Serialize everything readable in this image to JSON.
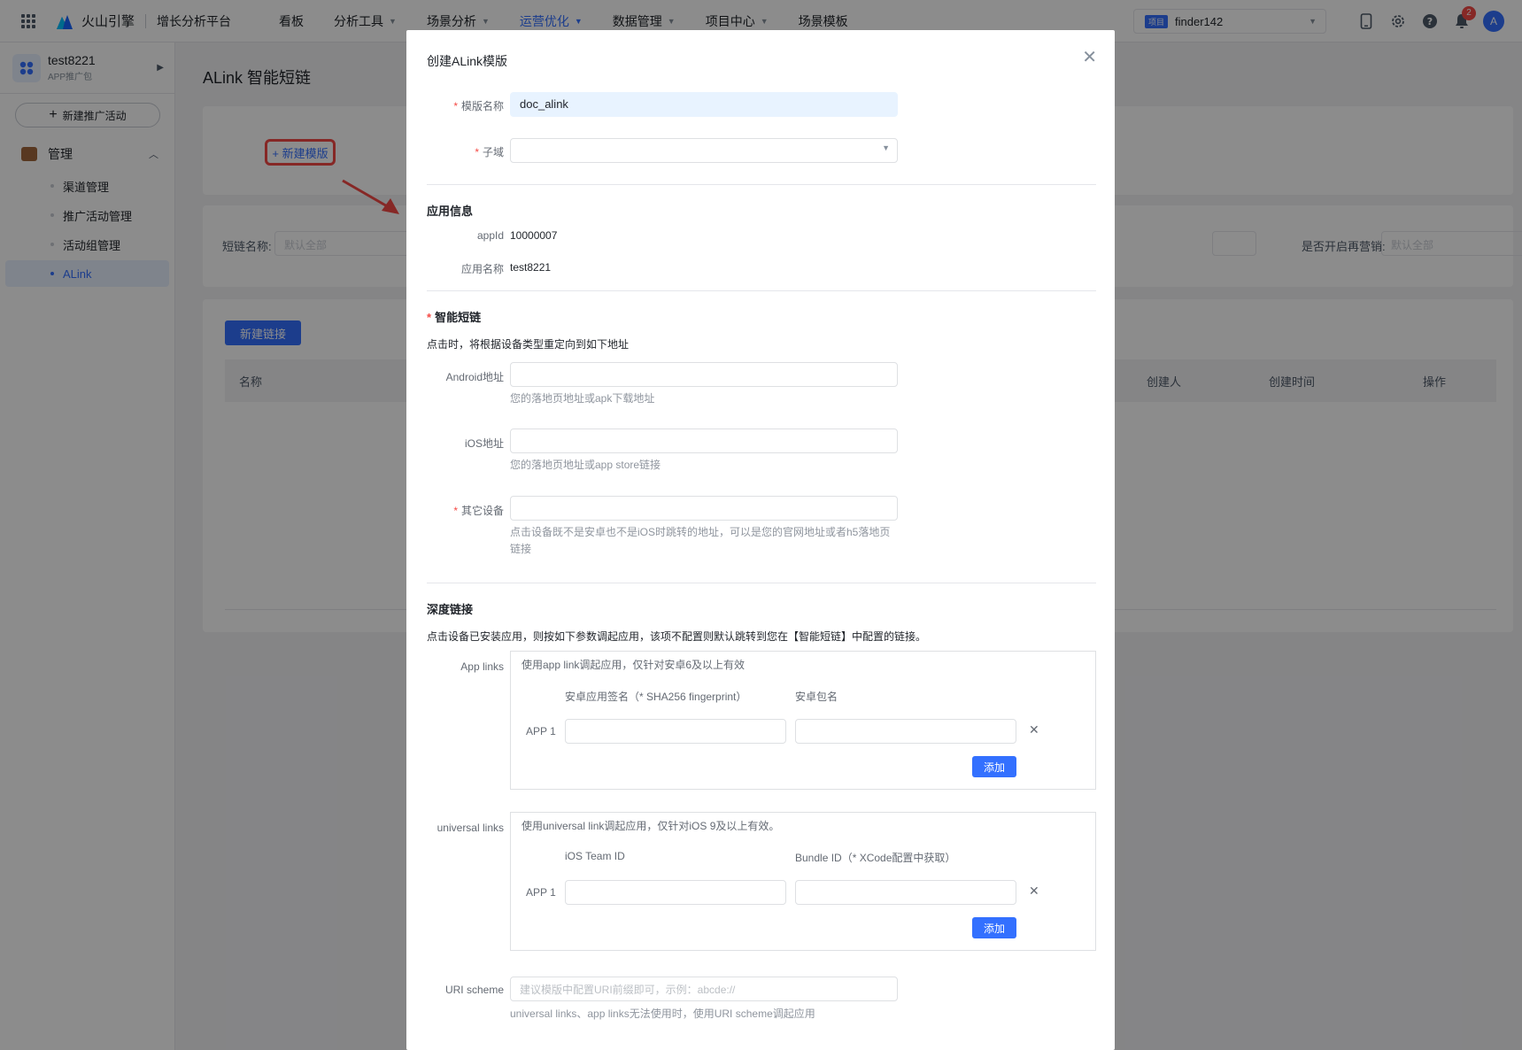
{
  "header": {
    "brand": "火山引擎",
    "platform": "增长分析平台",
    "nav": [
      {
        "label": "看板",
        "caret": false
      },
      {
        "label": "分析工具",
        "caret": true
      },
      {
        "label": "场景分析",
        "caret": true
      },
      {
        "label": "运营优化",
        "caret": true,
        "active": true
      },
      {
        "label": "数据管理",
        "caret": true
      },
      {
        "label": "项目中心",
        "caret": true
      },
      {
        "label": "场景模板",
        "caret": false
      }
    ],
    "project": {
      "tag": "项目",
      "name": "finder142"
    },
    "notification_count": "2",
    "avatar_letter": "A",
    "accent_color": "#3370ff"
  },
  "sidebar": {
    "app_name": "test8221",
    "app_sub": "APP推广包",
    "new_campaign": "新建推广活动",
    "group": "管理",
    "items": [
      {
        "label": "渠道管理"
      },
      {
        "label": "推广活动管理"
      },
      {
        "label": "活动组管理"
      },
      {
        "label": "ALink",
        "active": true
      }
    ]
  },
  "main": {
    "title": "ALink 智能短链",
    "new_template": "+ 新建模版",
    "filters": {
      "short_name_label": "短链名称:",
      "short_name_placeholder": "默认全部",
      "retarget_label": "是否开启再营销:",
      "retarget_placeholder": "默认全部"
    },
    "new_link": "新建链接",
    "columns": {
      "name": "名称",
      "creator": "创建人",
      "created_at": "创建时间",
      "action": "操作"
    }
  },
  "modal": {
    "title": "创建ALink模版",
    "template_name_label": "模版名称",
    "template_name_value": "doc_alink",
    "subdomain_label": "子域",
    "app_info_title": "应用信息",
    "appid_label": "appId",
    "appid_value": "10000007",
    "app_name_label": "应用名称",
    "app_name_value": "test8221",
    "smart_link_title": "智能短链",
    "smart_link_desc": "点击时，将根据设备类型重定向到如下地址",
    "android_label": "Android地址",
    "android_hint": "您的落地页地址或apk下载地址",
    "ios_label": "iOS地址",
    "ios_hint": "您的落地页地址或app store链接",
    "other_label": "其它设备",
    "other_hint": "点击设备既不是安卓也不是iOS时跳转的地址，可以是您的官网地址或者h5落地页链接",
    "deep_link_title": "深度链接",
    "deep_link_desc": "点击设备已安装应用，则按如下参数调起应用，该项不配置则默认跳转到您在【智能短链】中配置的链接。",
    "app_links": {
      "label": "App links",
      "desc": "使用app link调起应用，仅针对安卓6及以上有效",
      "col1": "安卓应用签名（* SHA256 fingerprint）",
      "col2": "安卓包名",
      "row_label": "APP 1",
      "add": "添加"
    },
    "universal_links": {
      "label": "universal links",
      "desc": "使用universal link调起应用，仅针对iOS 9及以上有效。",
      "col1": "iOS Team ID",
      "col2": "Bundle ID（* XCode配置中获取）",
      "row_label": "APP 1",
      "add": "添加"
    },
    "uri_scheme_label": "URI scheme",
    "uri_scheme_placeholder": "建议模版中配置URI前缀即可，示例：abcde://",
    "uri_scheme_hint": "universal links、app links无法使用时，使用URI scheme调起应用"
  }
}
